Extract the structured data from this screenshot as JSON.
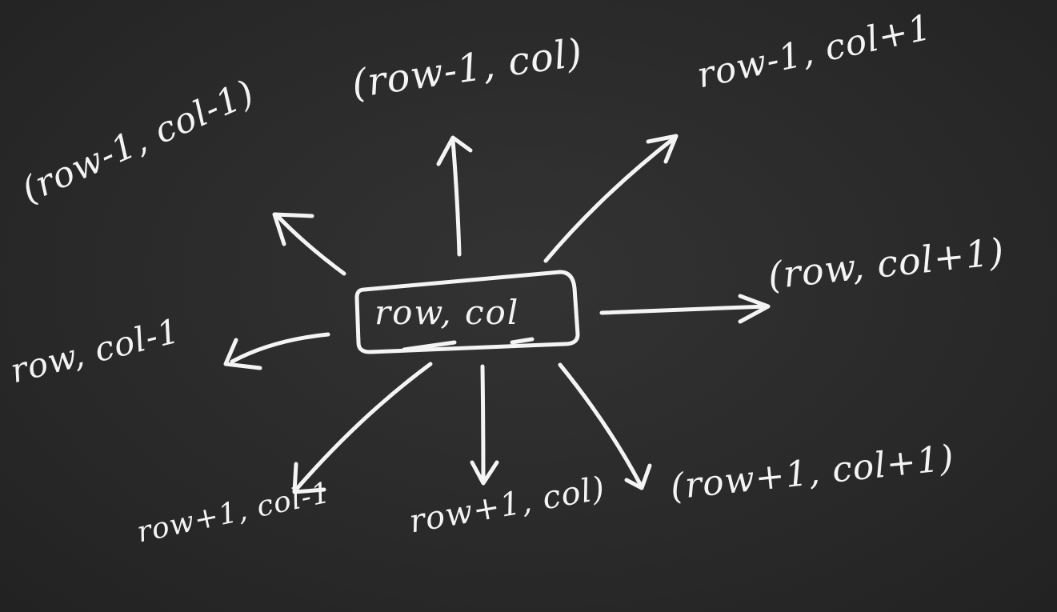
{
  "center": {
    "label": "row, col"
  },
  "neighbors": {
    "up_left": "(row-1, col-1)",
    "up": "(row-1, col)",
    "up_right": "row-1, col+1",
    "right": "(row, col+1)",
    "left": "row, col-1",
    "down_left": "row+1, col-1",
    "down": "row+1, col)",
    "down_right": "(row+1, col+1)"
  },
  "colors": {
    "board": "#2b2b2b",
    "chalk": "#f4f4f4"
  }
}
